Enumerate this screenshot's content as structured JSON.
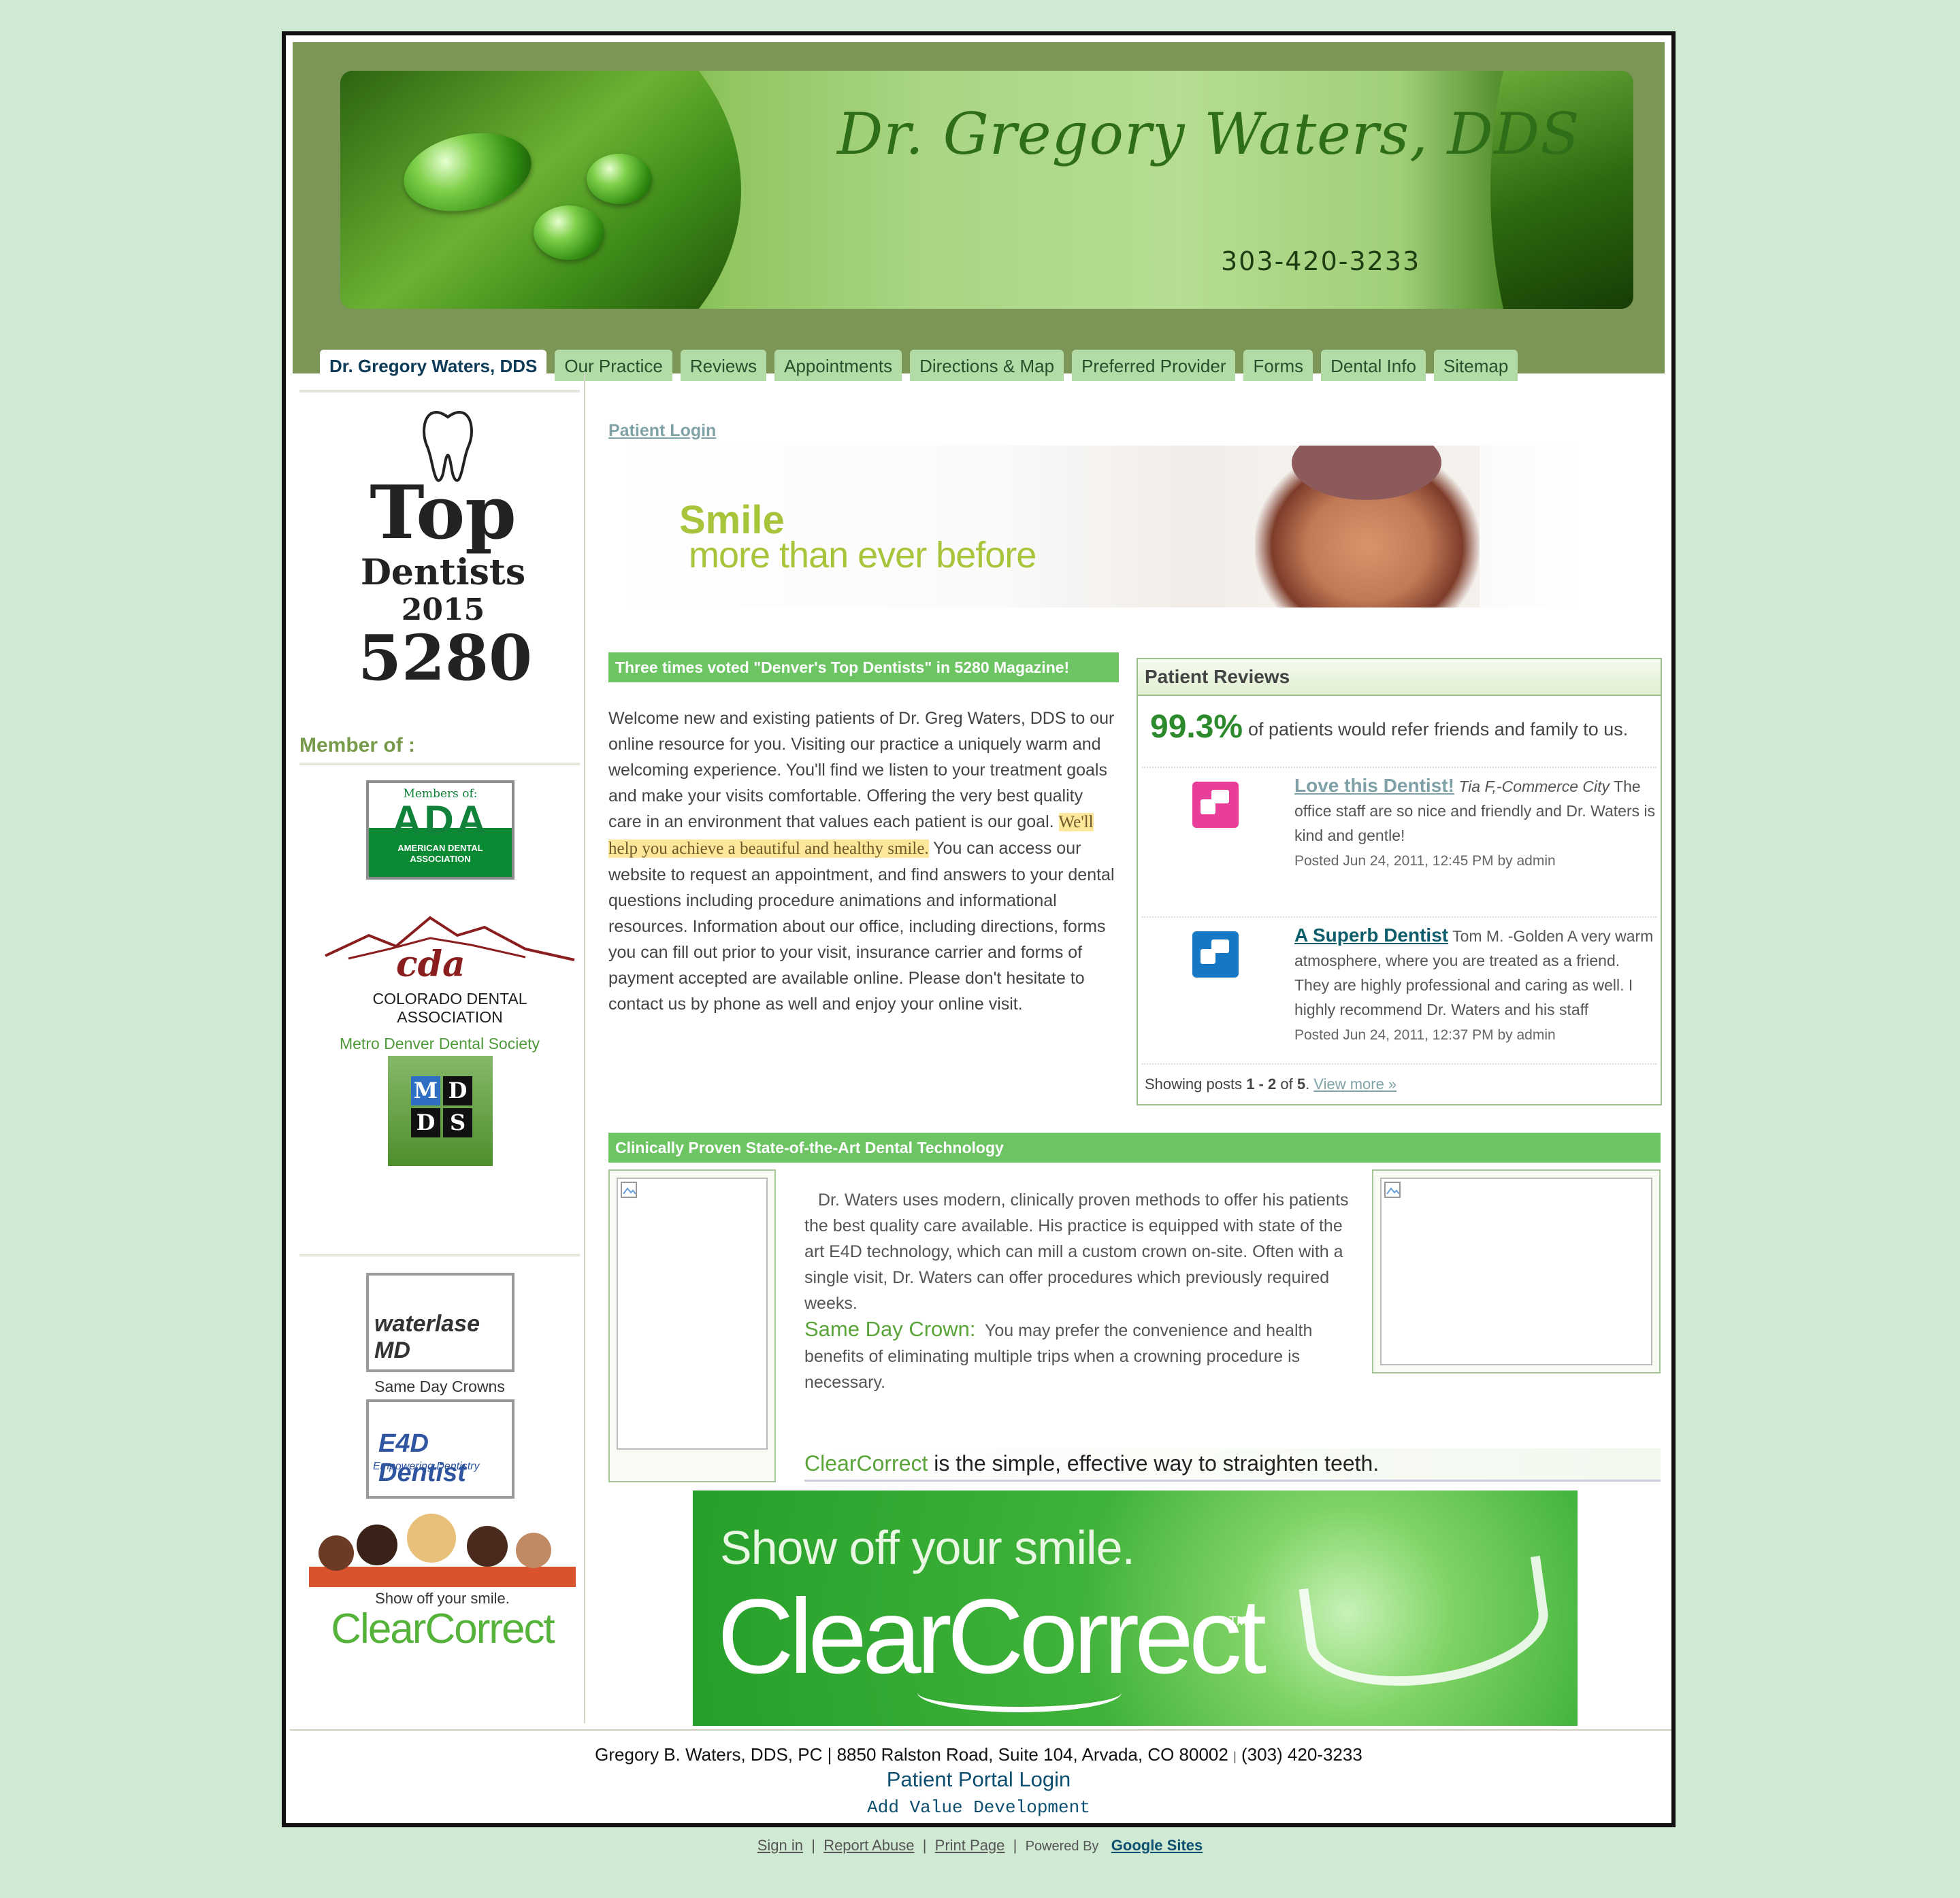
{
  "banner": {
    "title": "Dr. Gregory Waters, DDS",
    "phone": "303-420-3233"
  },
  "nav": {
    "tabs": [
      {
        "label": "Dr. Gregory Waters, DDS",
        "active": true
      },
      {
        "label": "Our Practice"
      },
      {
        "label": "Reviews"
      },
      {
        "label": "Appointments"
      },
      {
        "label": "Directions & Map"
      },
      {
        "label": "Preferred Provider"
      },
      {
        "label": "Forms"
      },
      {
        "label": "Dental Info"
      },
      {
        "label": "Sitemap"
      }
    ]
  },
  "sidebar": {
    "top_dentists": {
      "top": "Top",
      "dentists": "Dentists",
      "year": "2015",
      "magazine": "5280"
    },
    "member_title": "Member of :",
    "ada": {
      "members_of": "Members of:",
      "abbr": "ADA",
      "name": "AMERICAN DENTAL ASSOCIATION"
    },
    "cda": {
      "abbr": "cda",
      "name": "COLORADO DENTAL ASSOCIATION"
    },
    "mdds_label": "Metro Denver Dental Society",
    "mdds_letters": [
      "M",
      "D",
      "D",
      "S"
    ],
    "waterlase": "waterlase MD",
    "same_day_crowns": "Same Day Crowns",
    "e4d": {
      "title": "E4D Dentist",
      "subtitle": "Empowering Dentistry"
    },
    "clearcorrect": {
      "tagline": "Show off your smile.",
      "brand": "ClearCorrect"
    }
  },
  "main": {
    "patient_login": "Patient Login",
    "smile_banner": {
      "line1": "Smile",
      "line2": "more than ever before"
    },
    "voted_bar": "Three times voted \"Denver's Top Dentists\" in 5280 Magazine!",
    "welcome_before": "Welcome new and existing patients of Dr. Greg Waters, DDS to our online resource for you.  Visiting our practice a uniquely warm and welcoming experience.  You'll find we listen to your treatment goals and make your visits comfortable.  Offering the very best quality care in an environment that values each patient is our goal.  ",
    "welcome_highlight": "We'll help you achieve a beautiful and healthy smile.",
    "welcome_after": "  You can access our website to request an appointment, and find answers to your dental questions including procedure animations and informational resources.  Information about our office, including directions, forms you can fill out prior to your visit, insurance carrier and forms of payment accepted are available online.  Please don't hesitate to contact us by phone as well and enjoy your online visit.",
    "reviews": {
      "header": "Patient Reviews",
      "percent": "99.3%",
      "percent_text": "of patients would refer friends and family to us.",
      "items": [
        {
          "title": "Love this Dentist!",
          "author": "Tia F,-Commerce City",
          "text": "The office staff are so nice and friendly and Dr. Waters is kind and gentle!",
          "meta": "Posted Jun 24, 2011, 12:45 PM by admin"
        },
        {
          "title": "A Superb Dentist",
          "author": "Tom M. -Golden",
          "text": "A very warm atmosphere, where you are treated as a friend. They are highly professional and caring as well. I highly recommend Dr. Waters and his staff",
          "meta": "Posted Jun 24, 2011, 12:37 PM by admin"
        }
      ],
      "showing_prefix": "Showing posts ",
      "showing_range": "1 - 2",
      "showing_of": " of ",
      "showing_total": "5",
      "showing_dot": ". ",
      "view_more": "View more »"
    },
    "tech_bar": "Clinically Proven State-of-the-Art Dental Technology",
    "tech_text": "Dr. Waters uses modern, clinically proven methods to offer his patients the best quality care available.  His practice is equipped with state of the art E4D technology, which can mill a custom  crown on-site.  Often with a single visit, Dr. Waters can offer procedures which previously required weeks.",
    "same_day_label": "Same Day Crown:",
    "same_day_text": "You may prefer the convenience and health benefits of eliminating multiple trips when a crowning procedure is necessary.",
    "cc_line_brand": "ClearCorrect",
    "cc_line_text": " is the simple, effective way to straighten teeth.",
    "cc_banner": {
      "tagline": "Show off your smile.",
      "brand": "ClearCorrect",
      "tm": "TM"
    }
  },
  "footer": {
    "address": "Gregory B. Waters, DDS, PC | 8850 Ralston Road, Suite 104, Arvada, CO 80002",
    "separator": "|",
    "phone": "(303) 420-3233",
    "portal_login": "Patient Portal Login",
    "credit": "Add Value Development"
  },
  "bottom_links": {
    "sign_in": "Sign in",
    "report_abuse": "Report Abuse",
    "print_page": "Print Page",
    "powered_by": "Powered By",
    "google_sites": "Google Sites"
  },
  "colors": {
    "page_bg": "#cfe9d3",
    "header_band": "#7b9656",
    "tab_bg": "#b3dba6",
    "green_bar": "#6cc462",
    "review_pink": "#e83e9a",
    "review_blue": "#1478c4"
  }
}
